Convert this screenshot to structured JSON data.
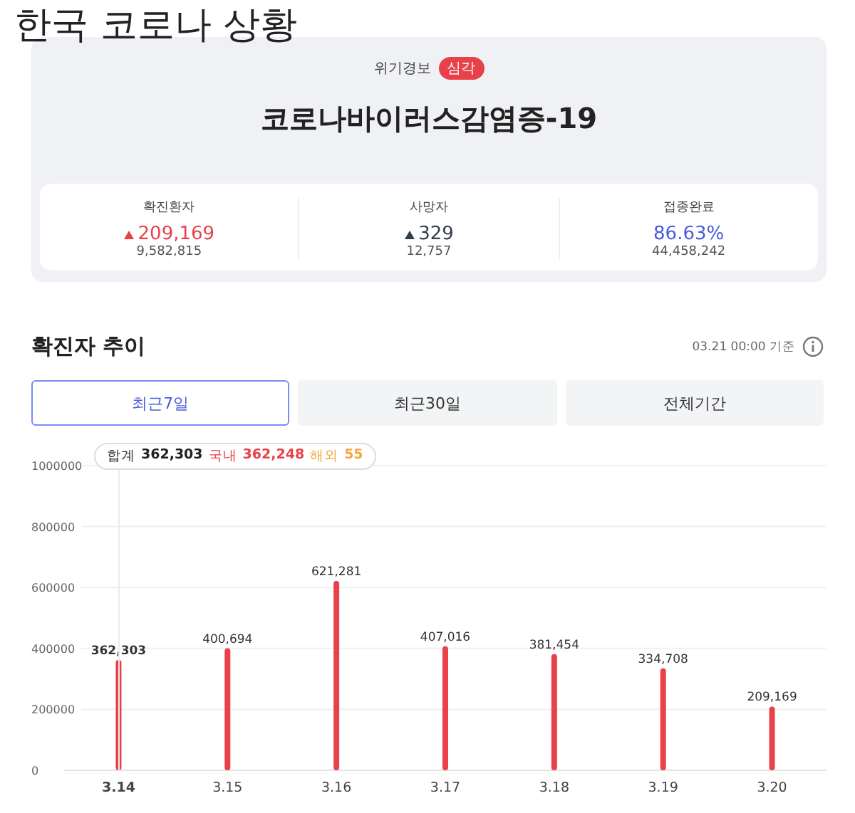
{
  "page_title": "한국 코로나 상황",
  "summary": {
    "alert_label": "위기경보",
    "alert_level": "심각",
    "disease": "코로나바이러스감염증-19",
    "stats": [
      {
        "label": "확진환자",
        "value": "209,169",
        "rising": true,
        "total": "9,582,815",
        "color": "#e8414a"
      },
      {
        "label": "사망자",
        "value": "329",
        "rising": true,
        "total": "12,757",
        "color": "#333d4b"
      },
      {
        "label": "접종완료",
        "value": "86.63%",
        "rising": false,
        "total": "44,458,242",
        "color": "#4a5bd9"
      }
    ]
  },
  "trend": {
    "title": "확진자 추이",
    "timestamp": "03.21 00:00 기준",
    "tabs": [
      {
        "label": "최근7일",
        "selected": true
      },
      {
        "label": "최근30일",
        "selected": false
      },
      {
        "label": "전체기간",
        "selected": false
      }
    ],
    "tooltip": [
      {
        "text": "합계",
        "kind": "label"
      },
      {
        "text": "362,303",
        "kind": "total"
      },
      {
        "text": "국내",
        "kind": "domestic-label"
      },
      {
        "text": "362,248",
        "kind": "domestic"
      },
      {
        "text": "해외",
        "kind": "overseas-label"
      },
      {
        "text": "55",
        "kind": "overseas"
      }
    ],
    "active_bars": [
      true,
      false,
      false,
      false,
      false,
      false,
      false
    ],
    "chart_data": {
      "type": "bar",
      "categories": [
        "3.14",
        "3.15",
        "3.16",
        "3.17",
        "3.18",
        "3.19",
        "3.20"
      ],
      "series": [
        {
          "color": "#e8414a",
          "values": [
            362303,
            400694,
            621281,
            407016,
            381454,
            334708,
            209169
          ]
        }
      ],
      "value_labels": [
        "362,303",
        "400,694",
        "621,281",
        "407,016",
        "381,454",
        "334,708",
        "209,169"
      ],
      "ylim": [
        0,
        1000000
      ],
      "yticks": [
        0,
        200000,
        400000,
        600000,
        800000,
        1000000
      ],
      "grid": true
    }
  }
}
